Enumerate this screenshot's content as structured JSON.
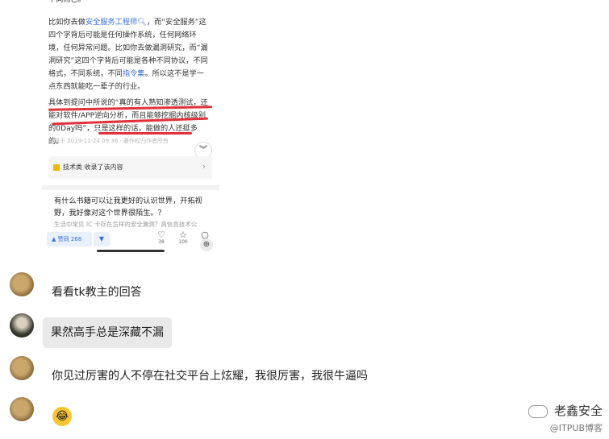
{
  "answer": {
    "line0": "不同而已。",
    "para1_pre": "比如你去做",
    "para1_link": "安全服务工程师",
    "para1_mid": "，而“安全服务”这四个字背后可能是任何操作系统，任何网络环境，任何异常问题。比如你去做漏洞研究，而“漏洞研究”这四个字背后可能是各种不同协议，不同格式，不同系统，不同",
    "para1_link2": "指令集",
    "para1_post": "。所以这不是学一点东西就能吃一辈子的行业。",
    "para2": "具体到提问中所说的“真的有人熟知渗透测试，还能对软件/APP逆向分析，而且能够挖掘内核级别的0Day吗”，只是这样的话，能做的人还挺多的。",
    "meta": "编辑于 2019-11-24 09:36 · 著作权归作者所有",
    "collect": "技术类 收录了该内容",
    "question": "有什么书籍可以让我更好的认识世界，开拓视野，我好像对这个世界很陌生。？",
    "question_sub": "生活中常见 IC 卡存在怎样的安全漏洞？高信息技术公",
    "vote_label": "赞同 268",
    "count_comment": "38",
    "count_star": "100"
  },
  "chat": [
    {
      "text": "看看tk教主的回答"
    },
    {
      "text": "果然高手总是深藏不漏"
    },
    {
      "text": "你见过厉害的人不停在社交平台上炫耀，我很厉害，我很牛逼吗"
    },
    {
      "text": "😂"
    }
  ],
  "watermark": {
    "name": "老鑫安全",
    "site": "@ITPUB博客"
  }
}
